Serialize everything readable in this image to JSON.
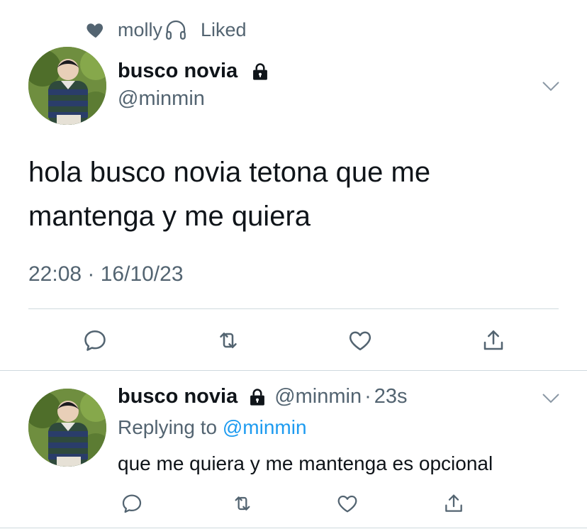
{
  "liked_by": {
    "name": "molly",
    "label": "Liked",
    "icons": [
      "heart-icon",
      "headphones-icon"
    ]
  },
  "tweet": {
    "display_name": "busco novia",
    "handle": "@minmin",
    "text_line1": "hola busco novia tetona que me",
    "text_line2": "mantenga y me quiera",
    "timestamp": "22:08 · 16/10/23",
    "actions": [
      "reply-icon",
      "retweet-icon",
      "like-icon",
      "share-icon"
    ]
  },
  "reply": {
    "display_name": "busco novia",
    "handle": "@minmin",
    "separator": "·",
    "time_ago": "23s",
    "replying_prefix": "Replying to",
    "replying_to": "@minmin",
    "text": "que me quiera y me mantenga es opcional",
    "actions": [
      "reply-icon",
      "retweet-icon",
      "like-icon",
      "share-icon"
    ]
  },
  "colors": {
    "secondary_text": "#536471",
    "link": "#1d9bf0",
    "divider": "#cfd9de"
  }
}
